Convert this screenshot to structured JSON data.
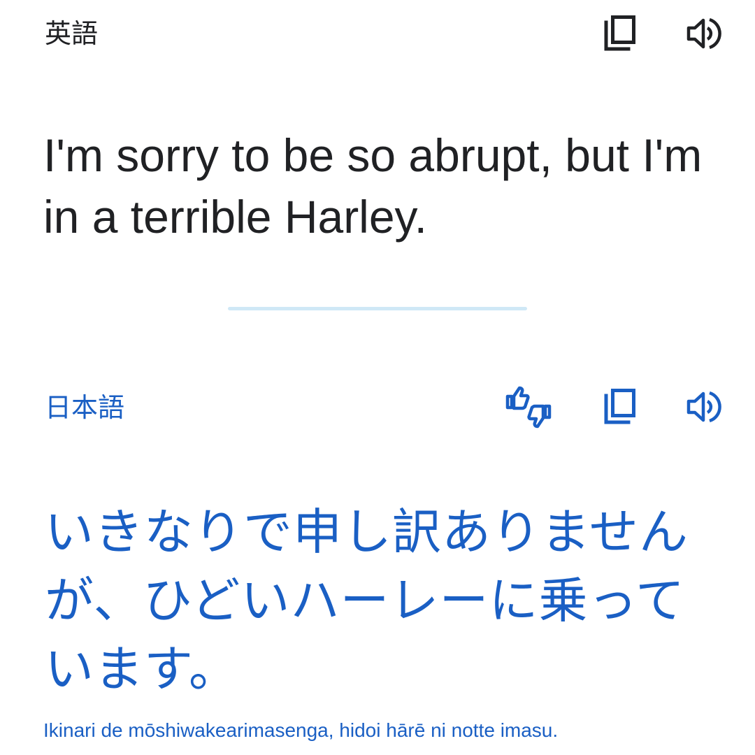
{
  "source": {
    "language": "英語",
    "text": "I'm sorry to be so abrupt, but I'm in a terrible Harley."
  },
  "target": {
    "language": "日本語",
    "text": "いきなりで申し訳ありませんが、ひどいハーレーに乗っています。",
    "romanization": "Ikinari de mōshiwakearimasenga, hidoi hārē ni notte imasu."
  },
  "icons": {
    "source_copy": "copy-icon",
    "source_speak": "volume-up-icon",
    "target_feedback": "thumbs-up-down-icon",
    "target_copy": "copy-icon",
    "target_speak": "volume-up-icon"
  },
  "colors": {
    "source_text": "#202124",
    "target_text": "#1a5fc4",
    "divider": "#cfe8f6",
    "background": "#ffffff"
  }
}
